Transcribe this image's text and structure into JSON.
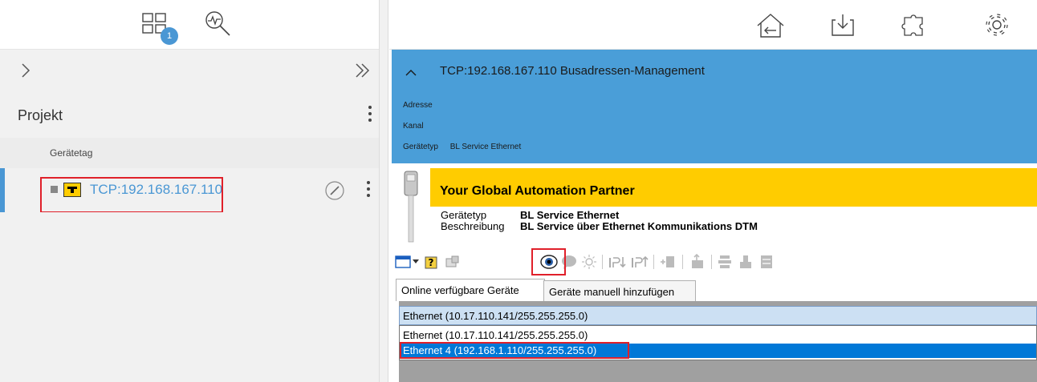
{
  "left_toolbar": {
    "badge_count": "1",
    "icons": [
      "grid-layout-icon",
      "diagnostic-search-icon"
    ]
  },
  "left_nav": {
    "expand_icon": "chevron-right-icon",
    "collapse_icon": "double-chevron-right-icon"
  },
  "project": {
    "title": "Projekt",
    "column_header": "Gerätetag",
    "tree": [
      {
        "label": "TCP:192.168.167.110",
        "highlighted": true
      }
    ]
  },
  "right_toolbar": {
    "icons": [
      "home-back-icon",
      "download-icon",
      "puzzle-icon",
      "settings-gear-icon"
    ]
  },
  "device_header": {
    "title": "TCP:192.168.167.110 Busadressen-Management",
    "fields": [
      {
        "label": "Adresse",
        "value": ""
      },
      {
        "label": "Kanal",
        "value": ""
      },
      {
        "label": "Gerätetyp",
        "value": "BL Service Ethernet"
      }
    ]
  },
  "dtm": {
    "banner": "Your Global Automation Partner",
    "info": [
      {
        "key": "Gerätetyp",
        "value": "BL Service Ethernet"
      },
      {
        "key": "Beschreibung",
        "value": "BL Service über Ethernet Kommunikations DTM"
      }
    ],
    "tabs": [
      {
        "label": "Online verfügbare Geräte",
        "active": true
      },
      {
        "label": "Geräte manuell hinzufügen",
        "active": false
      }
    ],
    "interface_select": {
      "selected": "Ethernet (10.17.110.141/255.255.255.0)",
      "options": [
        {
          "label": "Ethernet (10.17.110.141/255.255.255.0)",
          "selected": false
        },
        {
          "label": "Ethernet 4 (192.168.1.110/255.255.255.0)",
          "selected": true,
          "highlighted": true
        }
      ]
    }
  },
  "colors": {
    "accent_blue": "#4a9ed8",
    "brand_yellow": "#ffcc00",
    "highlight_red": "#e0202a",
    "selection_blue": "#0078d7"
  }
}
